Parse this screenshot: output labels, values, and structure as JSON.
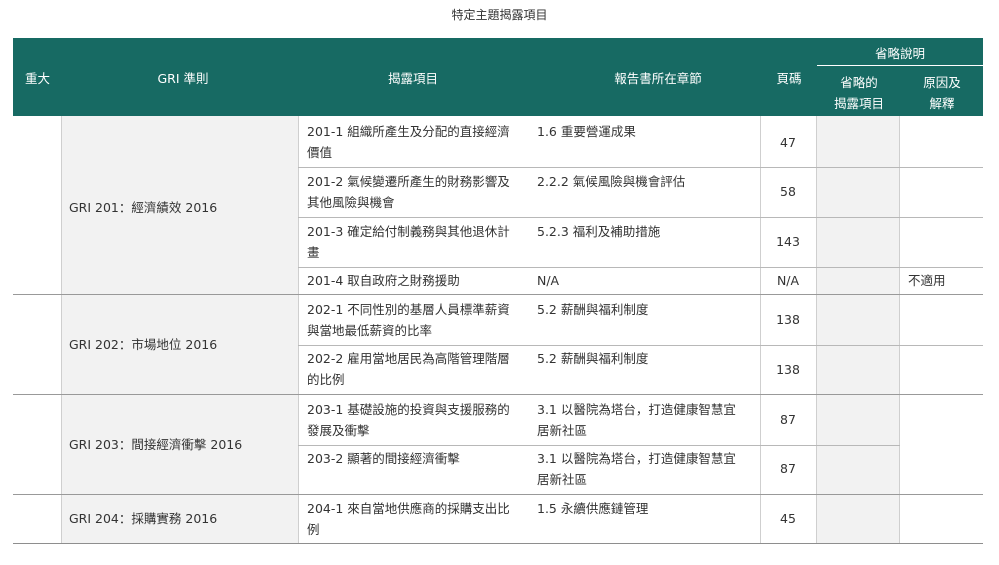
{
  "title": "特定主題揭露項目",
  "header": {
    "material": "重大",
    "gri": "GRI 準則",
    "disclosure": "揭露項目",
    "chapter": "報告書所在章節",
    "page": "頁碼",
    "omission": "省略說明",
    "omitted_item": [
      "省略的",
      "揭露項目"
    ],
    "reason": [
      "原因及",
      "解釋"
    ]
  },
  "groups": [
    {
      "gri": "GRI 201：經濟績效 2016",
      "rows": [
        {
          "disclosure": [
            "201-1 組織所產生及分配的直接經濟",
            "價值"
          ],
          "chapter": [
            "1.6 重要營運成果"
          ],
          "page": "47",
          "reason": ""
        },
        {
          "disclosure": [
            "201-2 氣候變遷所產生的財務影響及",
            "其他風險與機會"
          ],
          "chapter": [
            "2.2.2 氣候風險與機會評估"
          ],
          "page": "58",
          "reason": ""
        },
        {
          "disclosure": [
            "201-3 確定給付制義務與其他退休計",
            "畫"
          ],
          "chapter": [
            "5.2.3 福利及補助措施"
          ],
          "page": "143",
          "reason": ""
        },
        {
          "disclosure": [
            "201-4 取自政府之財務援助"
          ],
          "chapter": [
            "N/A"
          ],
          "page": "N/A",
          "reason": "不適用"
        }
      ]
    },
    {
      "gri": "GRI 202：市場地位 2016",
      "rows": [
        {
          "disclosure": [
            "202-1 不同性別的基層人員標準薪資",
            "與當地最低薪資的比率"
          ],
          "chapter": [
            "5.2 薪酬與福利制度"
          ],
          "page": "138",
          "reason": ""
        },
        {
          "disclosure": [
            "202-2 雇用當地居民為高階管理階層",
            "的比例"
          ],
          "chapter": [
            "5.2 薪酬與福利制度"
          ],
          "page": "138",
          "reason": ""
        }
      ]
    },
    {
      "gri": "GRI 203：間接經濟衝擊 2016",
      "rows": [
        {
          "disclosure": [
            "203-1 基礎設施的投資與支援服務的",
            "發展及衝擊"
          ],
          "chapter": [
            "3.1 以醫院為塔台，打造健康智慧宜",
            "居新社區"
          ],
          "page": "87",
          "reason": ""
        },
        {
          "disclosure": [
            "203-2 顯著的間接經濟衝擊"
          ],
          "chapter": [
            "3.1 以醫院為塔台，打造健康智慧宜",
            "居新社區"
          ],
          "page": "87",
          "reason": ""
        }
      ]
    },
    {
      "gri": "GRI 204：採購實務 2016",
      "rows": [
        {
          "disclosure": [
            "204-1 來自當地供應商的採購支出比",
            "例"
          ],
          "chapter": [
            "1.5 永續供應鏈管理"
          ],
          "page": "45",
          "reason": ""
        }
      ]
    }
  ]
}
